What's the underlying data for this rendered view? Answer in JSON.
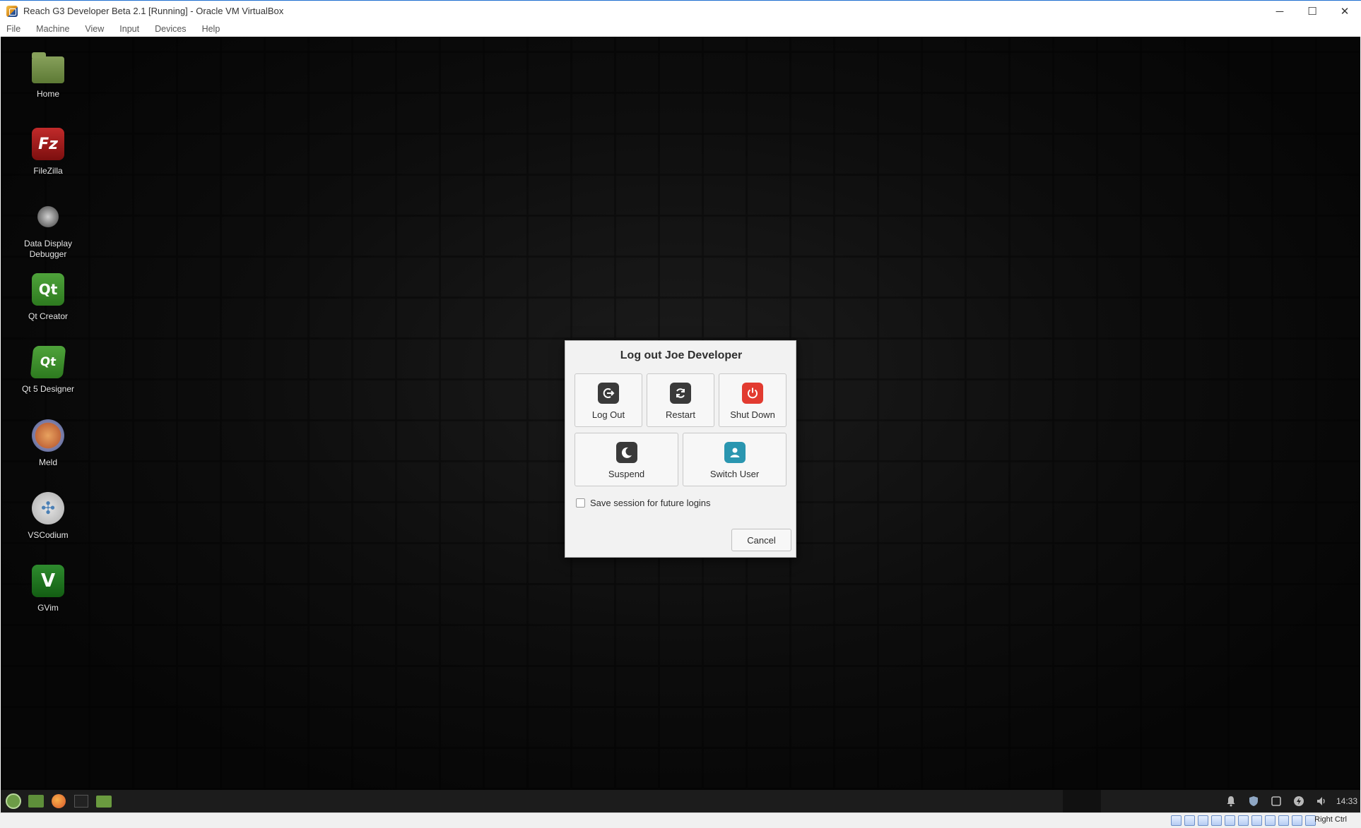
{
  "window": {
    "title": "Reach G3 Developer Beta 2.1 [Running] - Oracle VM VirtualBox",
    "controls": {
      "minimize": "─",
      "maximize": "☐",
      "close": "✕"
    }
  },
  "menubar": {
    "items": [
      "File",
      "Machine",
      "View",
      "Input",
      "Devices",
      "Help"
    ]
  },
  "desktop": {
    "icons": [
      {
        "label": "Home",
        "icon": "folder-home-icon"
      },
      {
        "label": "FileZilla",
        "icon": "filezilla-icon",
        "glyph": "Fz"
      },
      {
        "label": "Data Display Debugger",
        "icon": "ddd-icon"
      },
      {
        "label": "Qt Creator",
        "icon": "qt-creator-icon",
        "glyph": "Qt"
      },
      {
        "label": "Qt 5 Designer",
        "icon": "qt-designer-icon",
        "glyph": "Qt"
      },
      {
        "label": "Meld",
        "icon": "meld-icon"
      },
      {
        "label": "VSCodium",
        "icon": "vscodium-icon",
        "glyph": "✣"
      },
      {
        "label": "GVim",
        "icon": "gvim-icon",
        "glyph": "V"
      }
    ]
  },
  "dialog": {
    "title": "Log out Joe Developer",
    "buttons": {
      "logout": "Log Out",
      "restart": "Restart",
      "shutdown": "Shut Down",
      "suspend": "Suspend",
      "switch_user": "Switch User"
    },
    "save_session_label": "Save session for future logins",
    "save_session_checked": false,
    "cancel": "Cancel"
  },
  "panel": {
    "clock": "14:33"
  },
  "statusbar": {
    "host_key": "Right Ctrl"
  }
}
